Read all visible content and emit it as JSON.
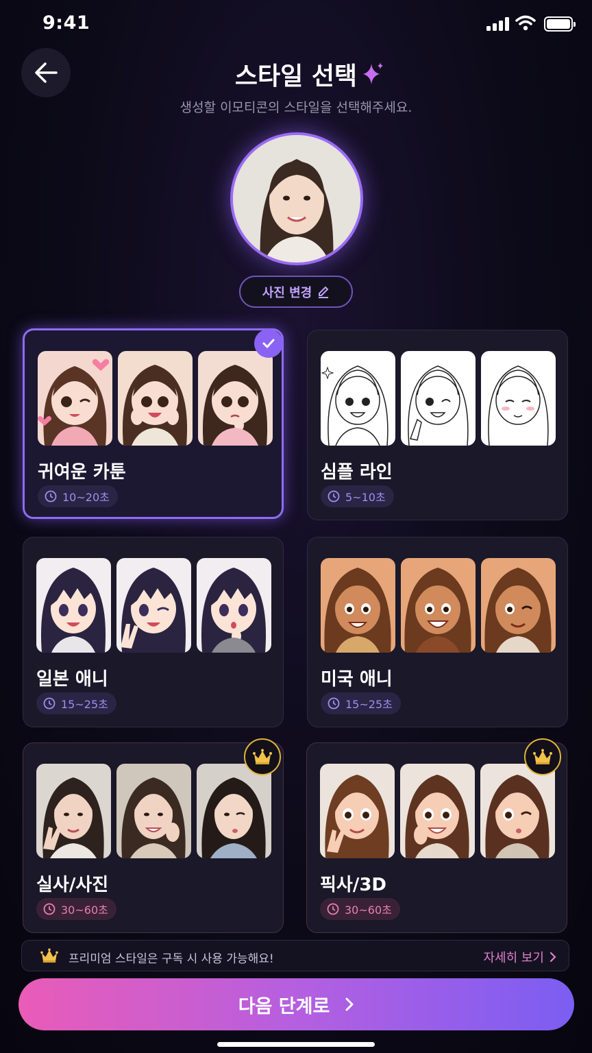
{
  "status_bar": {
    "time": "9:41"
  },
  "header": {
    "title": "스타일 선택",
    "subtitle": "생성할 이모티콘의 스타일을 선택해주세요."
  },
  "photo": {
    "change_label": "사진 변경"
  },
  "styles": [
    {
      "title": "귀여운 카툰",
      "time": "10~20초",
      "selected": true,
      "premium": false
    },
    {
      "title": "심플 라인",
      "time": "5~10초",
      "selected": false,
      "premium": false
    },
    {
      "title": "일본 애니",
      "time": "15~25초",
      "selected": false,
      "premium": false
    },
    {
      "title": "미국 애니",
      "time": "15~25초",
      "selected": false,
      "premium": false
    },
    {
      "title": "실사/사진",
      "time": "30~60초",
      "selected": false,
      "premium": true
    },
    {
      "title": "픽사/3D",
      "time": "30~60초",
      "selected": false,
      "premium": true
    }
  ],
  "notice": {
    "text": "프리미엄 스타일은 구독 시 사용 가능해요!",
    "link_label": "자세히 보기"
  },
  "next_button": {
    "label": "다음 단계로"
  },
  "colors": {
    "accent_purple": "#8e6cf7",
    "premium_gold": "#e1b43a",
    "gradient_start": "#ea5cb7",
    "gradient_end": "#7b5ef2"
  }
}
